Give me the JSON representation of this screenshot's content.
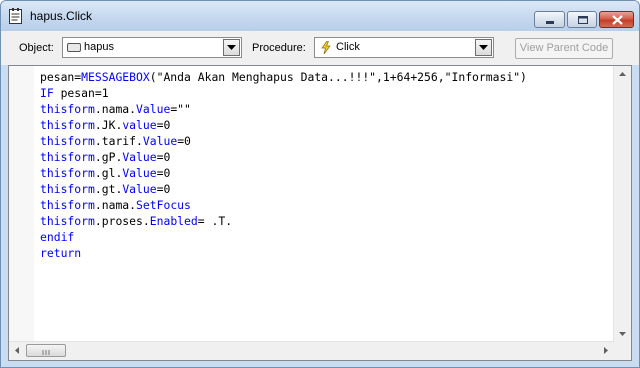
{
  "window": {
    "title": "hapus.Click",
    "icon": "code-window-icon"
  },
  "toolbar": {
    "object_label": "Object:",
    "object_value": "hapus",
    "object_icon": "button-icon",
    "procedure_label": "Procedure:",
    "procedure_value": "Click",
    "procedure_icon": "lightning-icon",
    "view_parent_label": "View Parent Code"
  },
  "editor": {
    "lines": [
      [
        {
          "t": "pesan="
        },
        {
          "t": "MESSAGEBOX",
          "k": 1
        },
        {
          "t": "(\"Anda Akan Menghapus Data...!!!\",1+64+256,\"Informasi\")"
        }
      ],
      [
        {
          "t": "IF",
          "k": 1
        },
        {
          "t": " pesan=1"
        }
      ],
      [
        {
          "t": "thisform",
          "k": 1
        },
        {
          "t": ".nama."
        },
        {
          "t": "Value",
          "k": 1
        },
        {
          "t": "=\"\""
        }
      ],
      [
        {
          "t": "thisform",
          "k": 1
        },
        {
          "t": ".JK."
        },
        {
          "t": "value",
          "k": 1
        },
        {
          "t": "=0"
        }
      ],
      [
        {
          "t": "thisform",
          "k": 1
        },
        {
          "t": ".tarif."
        },
        {
          "t": "Value",
          "k": 1
        },
        {
          "t": "=0"
        }
      ],
      [
        {
          "t": "thisform",
          "k": 1
        },
        {
          "t": ".gP."
        },
        {
          "t": "Value",
          "k": 1
        },
        {
          "t": "=0"
        }
      ],
      [
        {
          "t": "thisform",
          "k": 1
        },
        {
          "t": ".gl."
        },
        {
          "t": "Value",
          "k": 1
        },
        {
          "t": "=0"
        }
      ],
      [
        {
          "t": "thisform",
          "k": 1
        },
        {
          "t": ".gt."
        },
        {
          "t": "Value",
          "k": 1
        },
        {
          "t": "=0"
        }
      ],
      [
        {
          "t": "thisform",
          "k": 1
        },
        {
          "t": ".nama."
        },
        {
          "t": "SetFocus",
          "k": 1
        }
      ],
      [
        {
          "t": "thisform",
          "k": 1
        },
        {
          "t": ".proses."
        },
        {
          "t": "Enabled",
          "k": 1
        },
        {
          "t": "= .T."
        }
      ],
      [
        {
          "t": "endif",
          "k": 1
        }
      ],
      [
        {
          "t": "return",
          "k": 1
        }
      ]
    ]
  },
  "colors": {
    "keyword": "#0000ff",
    "text": "#000000",
    "titlebar": "#c6d9ef"
  }
}
